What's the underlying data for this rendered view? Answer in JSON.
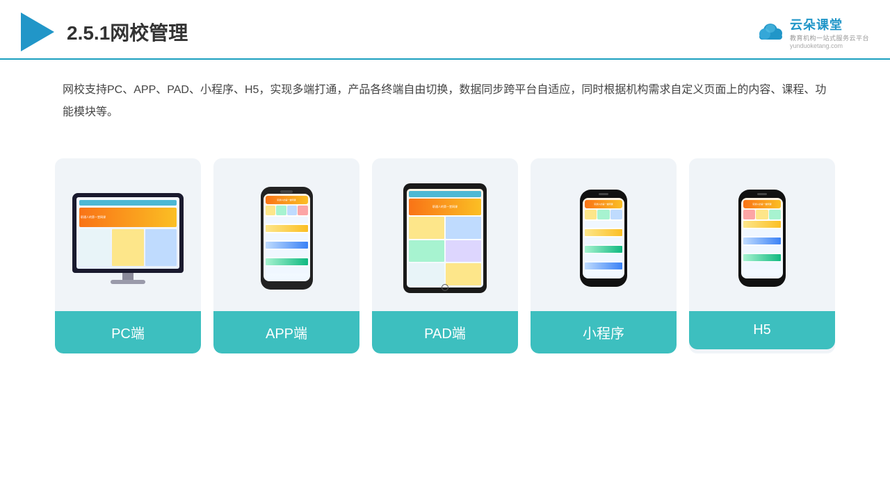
{
  "header": {
    "title": "2.5.1网校管理",
    "brand": {
      "name": "云朵课堂",
      "url": "yunduoketang.com",
      "tagline": "教育机构一站式服务云平台"
    }
  },
  "description": "网校支持PC、APP、PAD、小程序、H5，实现多端打通，产品各终端自由切换，数据同步跨平台自适应，同时根据机构需求自定义页面上的内容、课程、功能模块等。",
  "cards": [
    {
      "id": "pc",
      "label": "PC端"
    },
    {
      "id": "app",
      "label": "APP端"
    },
    {
      "id": "pad",
      "label": "PAD端"
    },
    {
      "id": "miniprogram",
      "label": "小程序"
    },
    {
      "id": "h5",
      "label": "H5"
    }
  ],
  "colors": {
    "accent": "#3dbfbf",
    "header_line": "#1a9fbf",
    "title_color": "#333333",
    "text_color": "#444444",
    "brand_color": "#2196c8"
  }
}
